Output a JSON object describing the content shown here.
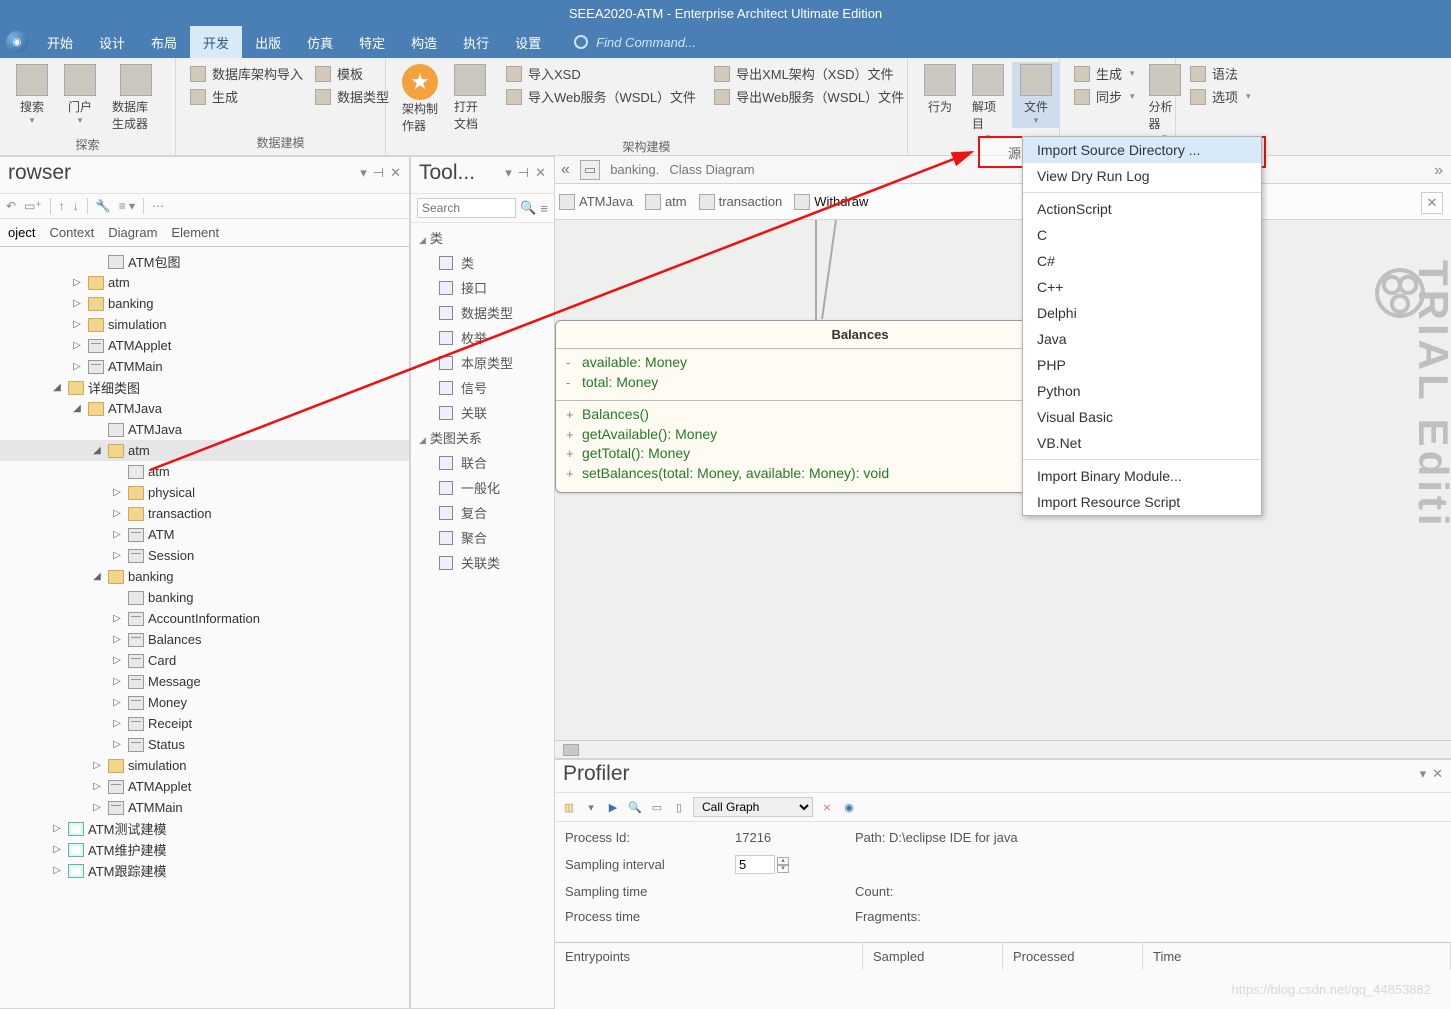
{
  "title": "SEEA2020-ATM - Enterprise Architect Ultimate Edition",
  "menubar": [
    "开始",
    "设计",
    "布局",
    "开发",
    "出版",
    "仿真",
    "特定",
    "构造",
    "执行",
    "设置"
  ],
  "menubar_active": "开发",
  "find_placeholder": "Find Command...",
  "ribbon": {
    "g1": {
      "label": "探索",
      "items": [
        "搜索",
        "门户",
        "数据库生成器"
      ]
    },
    "g2": {
      "label": "数据建模",
      "big": [],
      "small": [
        "数据库架构导入",
        "生成",
        "模板",
        "数据类型"
      ]
    },
    "g3": {
      "label": "架构建模",
      "big": [
        "架构制作器",
        "打开文档"
      ],
      "col2": [
        "导入XSD",
        "导入Web服务（WSDL）文件"
      ],
      "col3": [
        "导出XML架构（XSD）文件",
        "导出Web服务（WSDL）文件"
      ]
    },
    "g4": {
      "items": [
        "行为",
        "解项目",
        "文件"
      ]
    },
    "g5": {
      "small": [
        "生成",
        "同步"
      ],
      "big": "分析器"
    },
    "g6": {
      "small": [
        "语法",
        "选项"
      ]
    }
  },
  "browser": {
    "title": "rowser",
    "tabs": [
      "oject",
      "Context",
      "Diagram",
      "Element"
    ],
    "tree": [
      {
        "d": 3,
        "i": "pkg",
        "l": "ATM包图"
      },
      {
        "d": 2,
        "tw": "▷",
        "i": "fold",
        "l": "atm"
      },
      {
        "d": 2,
        "tw": "▷",
        "i": "fold",
        "l": "banking"
      },
      {
        "d": 2,
        "tw": "▷",
        "i": "fold",
        "l": "simulation"
      },
      {
        "d": 2,
        "tw": "▷",
        "i": "cls",
        "l": "ATMApplet"
      },
      {
        "d": 2,
        "tw": "▷",
        "i": "cls",
        "l": "ATMMain"
      },
      {
        "d": 1,
        "tw": "◢",
        "i": "fold",
        "l": "详细类图"
      },
      {
        "d": 2,
        "tw": "◢",
        "i": "fold",
        "l": "ATMJava"
      },
      {
        "d": 3,
        "i": "pkg",
        "l": "ATMJava"
      },
      {
        "d": 3,
        "tw": "◢",
        "i": "fold",
        "l": "atm",
        "sel": true
      },
      {
        "d": 4,
        "i": "pkg",
        "l": "atm"
      },
      {
        "d": 4,
        "tw": "▷",
        "i": "fold",
        "l": "physical"
      },
      {
        "d": 4,
        "tw": "▷",
        "i": "fold",
        "l": "transaction"
      },
      {
        "d": 4,
        "tw": "▷",
        "i": "cls",
        "l": "ATM"
      },
      {
        "d": 4,
        "tw": "▷",
        "i": "cls",
        "l": "Session"
      },
      {
        "d": 3,
        "tw": "◢",
        "i": "fold",
        "l": "banking"
      },
      {
        "d": 4,
        "i": "pkg",
        "l": "banking"
      },
      {
        "d": 4,
        "tw": "▷",
        "i": "cls",
        "l": "AccountInformation"
      },
      {
        "d": 4,
        "tw": "▷",
        "i": "cls",
        "l": "Balances"
      },
      {
        "d": 4,
        "tw": "▷",
        "i": "cls",
        "l": "Card"
      },
      {
        "d": 4,
        "tw": "▷",
        "i": "cls",
        "l": "Message"
      },
      {
        "d": 4,
        "tw": "▷",
        "i": "cls",
        "l": "Money"
      },
      {
        "d": 4,
        "tw": "▷",
        "i": "cls",
        "l": "Receipt"
      },
      {
        "d": 4,
        "tw": "▷",
        "i": "cls",
        "l": "Status"
      },
      {
        "d": 3,
        "tw": "▷",
        "i": "fold",
        "l": "simulation"
      },
      {
        "d": 3,
        "tw": "▷",
        "i": "cls",
        "l": "ATMApplet"
      },
      {
        "d": 3,
        "tw": "▷",
        "i": "cls",
        "l": "ATMMain"
      },
      {
        "d": 1,
        "tw": "▷",
        "i": "mdl",
        "l": "ATM测试建模"
      },
      {
        "d": 1,
        "tw": "▷",
        "i": "mdl",
        "l": "ATM维护建模"
      },
      {
        "d": 1,
        "tw": "▷",
        "i": "mdl",
        "l": "ATM跟踪建模"
      }
    ]
  },
  "toolbox": {
    "title": "Tool...",
    "search": "Search",
    "cat1": "类",
    "items1": [
      "类",
      "接口",
      "数据类型",
      "枚举",
      "本原类型",
      "信号",
      "关联"
    ],
    "cat2": "类图关系",
    "items2": [
      "联合",
      "一般化",
      "复合",
      "聚合",
      "关联类"
    ]
  },
  "diagram": {
    "path": "banking.",
    "type": "Class Diagram",
    "crumbs": [
      "ATMJava",
      "atm",
      "transaction",
      "Withdraw"
    ],
    "uml_title": "Balances",
    "attrs": [
      {
        "s": "-",
        "t": "available: Money"
      },
      {
        "s": "-",
        "t": "total: Money"
      }
    ],
    "ops": [
      {
        "s": "+",
        "t": "Balances()"
      },
      {
        "s": "+",
        "t": "getAvailable(): Money"
      },
      {
        "s": "+",
        "t": "getTotal(): Money"
      },
      {
        "s": "+",
        "t": "setBalances(total: Money, available: Money): void"
      }
    ]
  },
  "dropdown": {
    "truncated_label": "源",
    "highlight": "Import Source Directory ...",
    "items": [
      "View Dry Run Log",
      "ActionScript",
      "C",
      "C#",
      "C++",
      "Delphi",
      "Java",
      "PHP",
      "Python",
      "Visual Basic",
      "VB.Net",
      "Import Binary Module...",
      "Import Resource Script"
    ]
  },
  "profiler": {
    "title": "Profiler",
    "combo": "Call Graph",
    "rows": {
      "pid_l": "Process Id:",
      "pid_v": "17216",
      "path_l": "Path:",
      "path_v": "D:\\eclipse IDE for java",
      "si_l": "Sampling interval",
      "si_v": "5",
      "st_l": "Sampling time",
      "cnt_l": "Count:",
      "pt_l": "Process time",
      "frg_l": "Fragments:"
    },
    "cols": [
      "Entrypoints",
      "Sampled",
      "Processed",
      "Time"
    ]
  },
  "trial": "TRIAL Editi",
  "watermark": "https://blog.csdn.net/qq_44853882"
}
